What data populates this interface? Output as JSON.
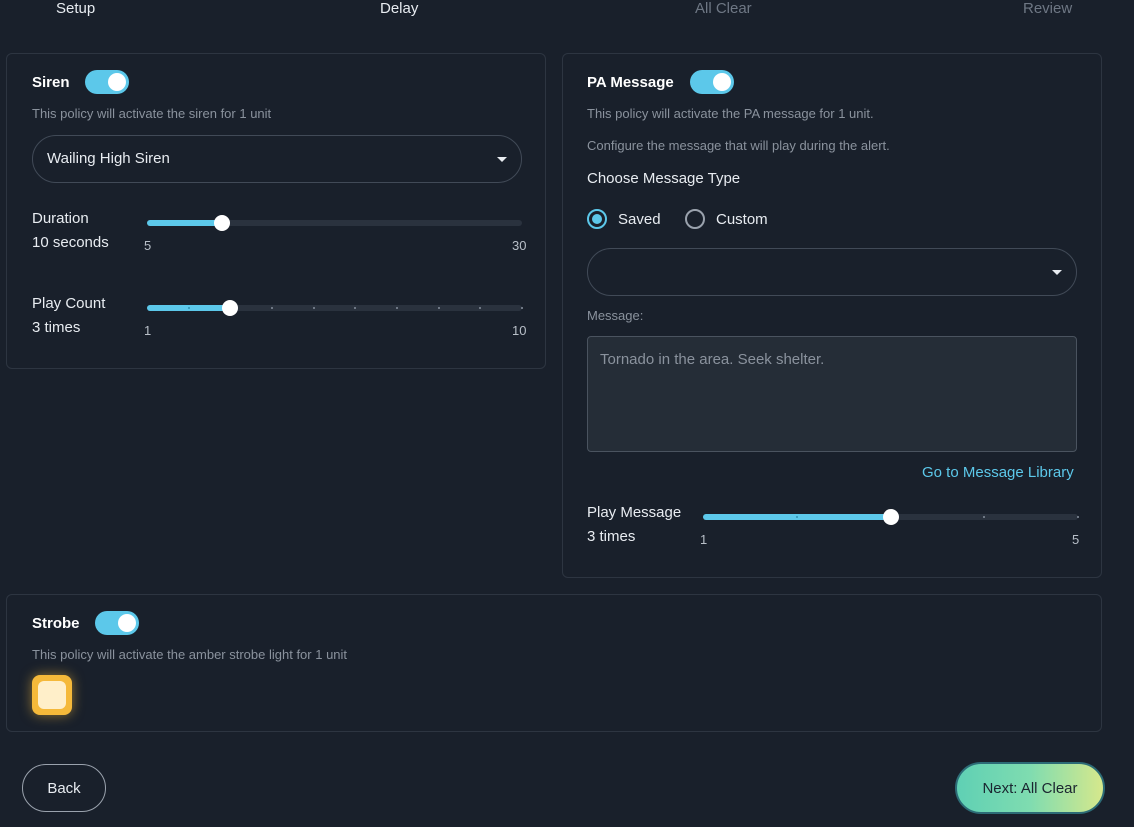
{
  "steps": [
    {
      "label": "Setup",
      "state": "done"
    },
    {
      "label": "Delay",
      "state": "done"
    },
    {
      "label": "All Clear",
      "state": "todo"
    },
    {
      "label": "Review",
      "state": "todo"
    }
  ],
  "siren": {
    "title": "Siren",
    "enabled": true,
    "description": "This policy will activate the siren for 1 unit",
    "sound": "Wailing High Siren",
    "duration": {
      "label": "Duration",
      "value_text": "10 seconds",
      "value": 10,
      "min": 5,
      "max": 30,
      "min_label": "5",
      "max_label": "30"
    },
    "play_count": {
      "label": "Play Count",
      "value_text": "3 times",
      "value": 3,
      "min": 1,
      "max": 10,
      "min_label": "1",
      "max_label": "10"
    }
  },
  "pa": {
    "title": "PA Message",
    "enabled": true,
    "description": "This policy will activate the PA message for 1 unit.",
    "instructions": "Configure the message that will play during the alert.",
    "type_label": "Choose Message Type",
    "options": [
      "Saved",
      "Custom"
    ],
    "selected_option": "Saved",
    "saved_message": "",
    "message_label": "Message:",
    "message_placeholder": "Tornado in the area. Seek shelter.",
    "library_link": "Go to Message Library",
    "play_message": {
      "label": "Play Message",
      "value_text": "3 times",
      "value": 3,
      "min": 1,
      "max": 5,
      "min_label": "1",
      "max_label": "5"
    }
  },
  "strobe": {
    "title": "Strobe",
    "enabled": true,
    "description": "This policy will activate the amber strobe light for 1 unit",
    "color": "#f5b93a"
  },
  "footer": {
    "back_label": "Back",
    "next_label": "Next: All Clear"
  },
  "colors": {
    "accent": "#5cc8ea",
    "background": "#19202b",
    "amber": "#f5b93a"
  }
}
